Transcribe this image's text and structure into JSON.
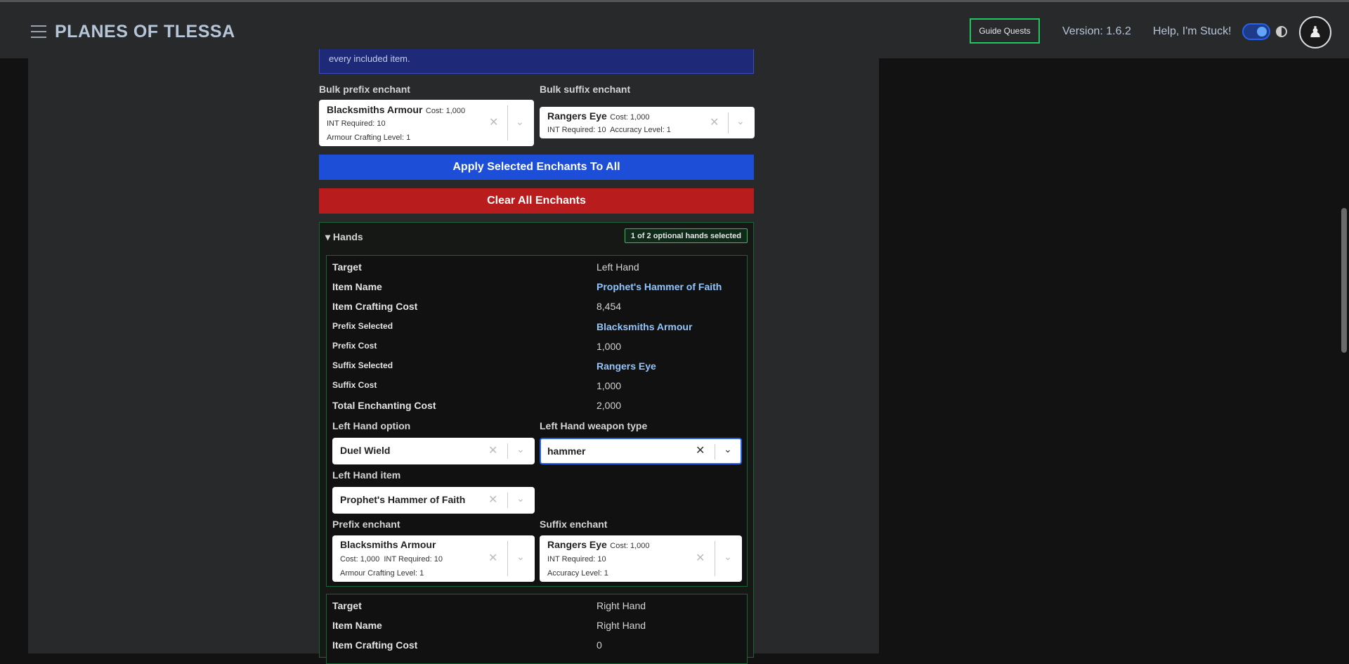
{
  "header": {
    "brand": "PLANES OF TLESSA",
    "guide_quests": "Guide Quests",
    "version": "Version: 1.6.2",
    "help": "Help, I'm Stuck!"
  },
  "info_text": "every included item.",
  "bulk": {
    "prefix_label": "Bulk prefix enchant",
    "suffix_label": "Bulk suffix enchant",
    "prefix": {
      "name": "Blacksmiths Armour",
      "cost": "Cost: 1,000",
      "line2": "INT Required: 10",
      "line3": "Armour Crafting Level: 1"
    },
    "suffix": {
      "name": "Rangers Eye",
      "cost": "Cost: 1,000",
      "line2": "INT Required: 10  Accuracy Level: 1"
    }
  },
  "buttons": {
    "apply": "Apply Selected Enchants To All",
    "clear": "Clear All Enchants"
  },
  "hands": {
    "title": "▾ Hands",
    "badge": "1 of 2 optional hands selected",
    "left": {
      "rows": [
        {
          "label": "Target",
          "value": "Left Hand"
        },
        {
          "label": "Item Name",
          "value": "Prophet's Hammer of Faith"
        },
        {
          "label": "Item Crafting Cost",
          "value": "8,454"
        },
        {
          "label": "Prefix Selected",
          "value": "Blacksmiths Armour"
        },
        {
          "label": "Prefix Cost",
          "value": "1,000"
        },
        {
          "label": "Suffix Selected",
          "value": "Rangers Eye"
        },
        {
          "label": "Suffix Cost",
          "value": "1,000"
        },
        {
          "label": "Total Enchanting Cost",
          "value": "2,000"
        }
      ],
      "option_label": "Left Hand option",
      "option_value": "Duel Wield",
      "weapon_label": "Left Hand weapon type",
      "weapon_value": "hammer",
      "item_label": "Left Hand item",
      "item_value": "Prophet's Hammer of Faith",
      "prefix_label": "Prefix enchant",
      "prefix": {
        "name": "Blacksmiths Armour",
        "line2": "Cost: 1,000  INT Required: 10",
        "line3": "Armour Crafting Level: 1"
      },
      "suffix_label": "Suffix enchant",
      "suffix": {
        "name": "Rangers Eye",
        "cost": "Cost: 1,000",
        "line2": "INT Required: 10",
        "line3": "Accuracy Level: 1"
      }
    },
    "right": {
      "rows": [
        {
          "label": "Target",
          "value": "Right Hand"
        },
        {
          "label": "Item Name",
          "value": "Right Hand"
        },
        {
          "label": "Item Crafting Cost",
          "value": "0"
        }
      ]
    }
  }
}
